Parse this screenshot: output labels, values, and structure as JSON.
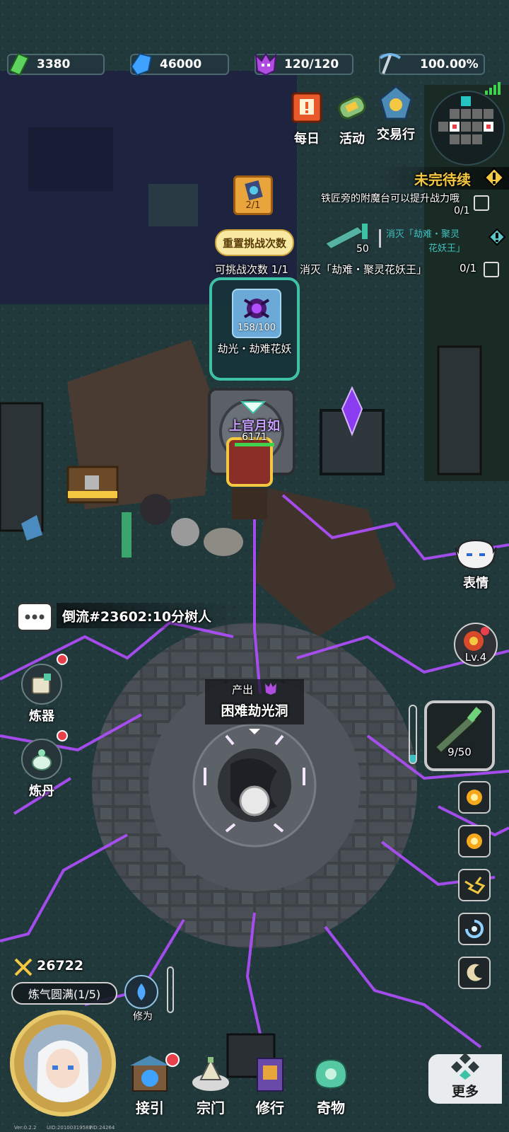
{
  "resources": [
    {
      "name": "jade",
      "icon": "green-crystal-icon",
      "value": "3380",
      "color": "#5fd35f"
    },
    {
      "name": "spirit-stone",
      "icon": "blue-crystal-icon",
      "value": "46000",
      "color": "#3fa2ff"
    },
    {
      "name": "energy",
      "icon": "purple-demon-icon",
      "value": "120/120",
      "color": "#b04ce0"
    },
    {
      "name": "rate",
      "icon": "pickaxe-icon",
      "value": "100.00%",
      "color": "#6fb7e8"
    }
  ],
  "top_buttons": [
    {
      "label": "每日",
      "icon": "daily-scroll-icon"
    },
    {
      "label": "活动",
      "icon": "event-scroll-icon"
    },
    {
      "label": "交易行",
      "icon": "trade-emblem-icon"
    }
  ],
  "quest": {
    "header": "未完待续",
    "line1": "铁匠旁的附魔台可以提升战力哦",
    "line1_progress": "0/1",
    "target_label": "消灭「劫难・聚灵",
    "target_label2": "花妖王」",
    "reward_count": "50",
    "line2": "消灭「劫难・聚灵花妖王」",
    "line2_progress": "0/1"
  },
  "challenge": {
    "ticket": "2/1",
    "reset_button": "重置挑战次数",
    "remaining": "可挑战次数 1/1",
    "boss_count": "158/100",
    "boss_name": "劫光・劫难花妖"
  },
  "player": {
    "name": "上官月如",
    "hp": "6171"
  },
  "chat": {
    "message": "倒流#23602:10分树人"
  },
  "left_buttons": [
    {
      "label": "炼器",
      "icon": "forge-icon"
    },
    {
      "label": "炼丹",
      "icon": "alchemy-icon"
    }
  ],
  "right_panel": {
    "emote_label": "表情",
    "level_label": "Lv.4",
    "weapon_count": "9/50"
  },
  "dungeon": {
    "produce_label": "产出",
    "name": "困难劫光洞"
  },
  "status": {
    "power": "26722",
    "realm": "炼气圆满(1/5)",
    "cultivation_label": "修为"
  },
  "bottom_nav": [
    {
      "label": "接引",
      "icon": "summon-gate-icon"
    },
    {
      "label": "宗门",
      "icon": "sect-icon"
    },
    {
      "label": "修行",
      "icon": "cultivation-book-icon"
    },
    {
      "label": "奇物",
      "icon": "treasure-icon"
    }
  ],
  "more_label": "更多",
  "footer": {
    "version": "Ver:0.2.2",
    "uid": "UID:20100319581",
    "pid": "PID:24264"
  },
  "colors": {
    "accent_gold": "#f5c842",
    "teal_frame": "#3ec2a6",
    "purple_lightning": "#b14fff"
  }
}
